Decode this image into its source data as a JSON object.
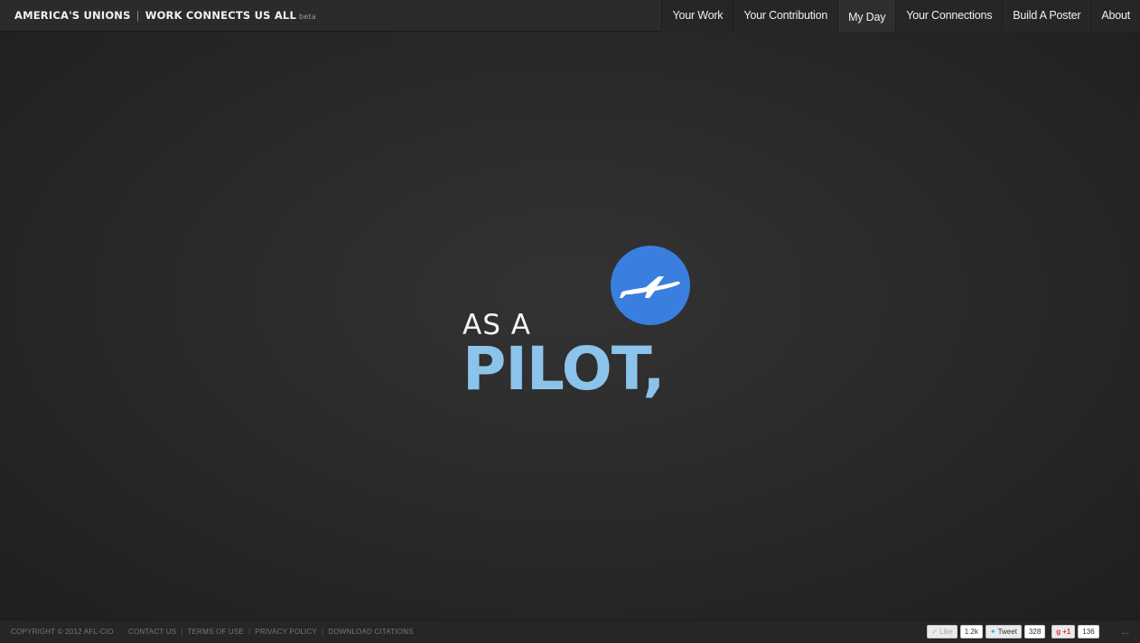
{
  "header": {
    "brand_primary": "AMERICA'S UNIONS",
    "brand_separator": "|",
    "brand_secondary": "WORK CONNECTS US ALL",
    "brand_badge": "beta"
  },
  "nav": {
    "items": [
      {
        "label": "Your Work"
      },
      {
        "label": "Your Contribution"
      },
      {
        "label": "My Day"
      },
      {
        "label": "Your Connections"
      },
      {
        "label": "Build A Poster"
      },
      {
        "label": "About"
      }
    ],
    "active": "My Day"
  },
  "hero": {
    "prefix": "AS A",
    "role": "PILOT,",
    "icon": "airplane-icon",
    "icon_color": "#3a7fe0",
    "role_color": "#8cc3ea"
  },
  "footer": {
    "copyright": "COPYRIGHT © 2012 AFL-CIO",
    "links": [
      "CONTACT US",
      "TERMS OF USE",
      "PRIVACY POLICY",
      "DOWNLOAD CITATIONS"
    ]
  },
  "social": {
    "like_label": "Like",
    "like_count": "1.2k",
    "tweet_label": "Tweet",
    "tweet_count": "328",
    "gplus_label": "+1",
    "gplus_count": "136",
    "more": "..."
  }
}
